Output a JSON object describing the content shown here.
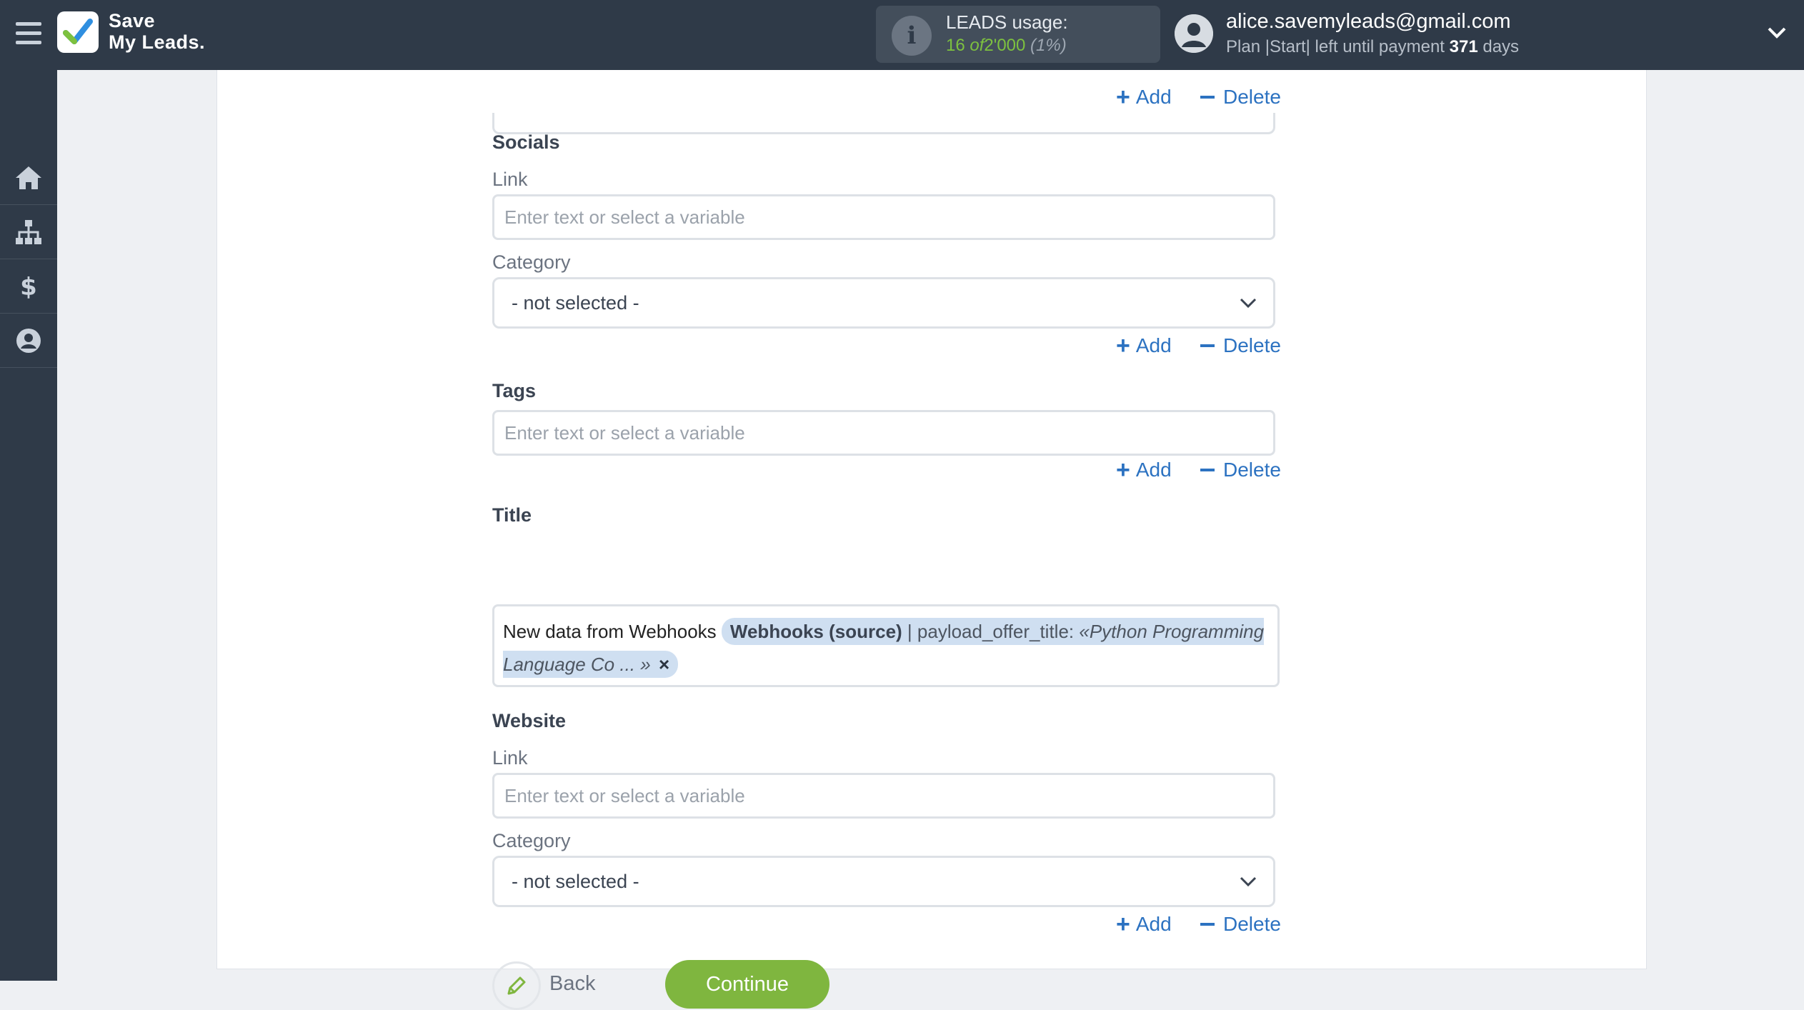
{
  "app": {
    "logo_line1": "Save",
    "logo_line2": "My Leads."
  },
  "usage": {
    "label": "LEADS usage:",
    "used": "16",
    "of": "of",
    "total": "2'000",
    "percent": "(1%)",
    "info_icon": "i"
  },
  "user": {
    "email": "alice.savemyleads@gmail.com",
    "plan_prefix": "Plan |Start| left until payment",
    "days": "371",
    "days_suffix": "days"
  },
  "sidebar": {
    "items": [
      "home-icon",
      "sitemap-icon",
      "dollar-icon",
      "user-icon"
    ]
  },
  "actions": {
    "add": "Add",
    "delete": "Delete"
  },
  "form": {
    "socials": {
      "heading": "Socials",
      "link_label": "Link",
      "link_placeholder": "Enter text or select a variable",
      "category_label": "Category",
      "category_value": "- not selected -"
    },
    "tags": {
      "heading": "Tags",
      "placeholder": "Enter text or select a variable"
    },
    "title": {
      "heading": "Title",
      "text": "New data from Webhooks",
      "chip_source": "Webhooks (source)",
      "chip_sep": "| payload_offer_title:",
      "chip_value": "«Python Programming Language Co ... »",
      "chip_remove": "×"
    },
    "website": {
      "heading": "Website",
      "link_label": "Link",
      "link_placeholder": "Enter text or select a variable",
      "category_label": "Category",
      "category_value": "- not selected -"
    }
  },
  "buttons": {
    "back": "Back",
    "continue": "Continue"
  },
  "colors": {
    "topbar": "#2f3a48",
    "accent_blue": "#2c72c1",
    "continue_green": "#7fb63f",
    "usage_green": "#7dc13f"
  }
}
